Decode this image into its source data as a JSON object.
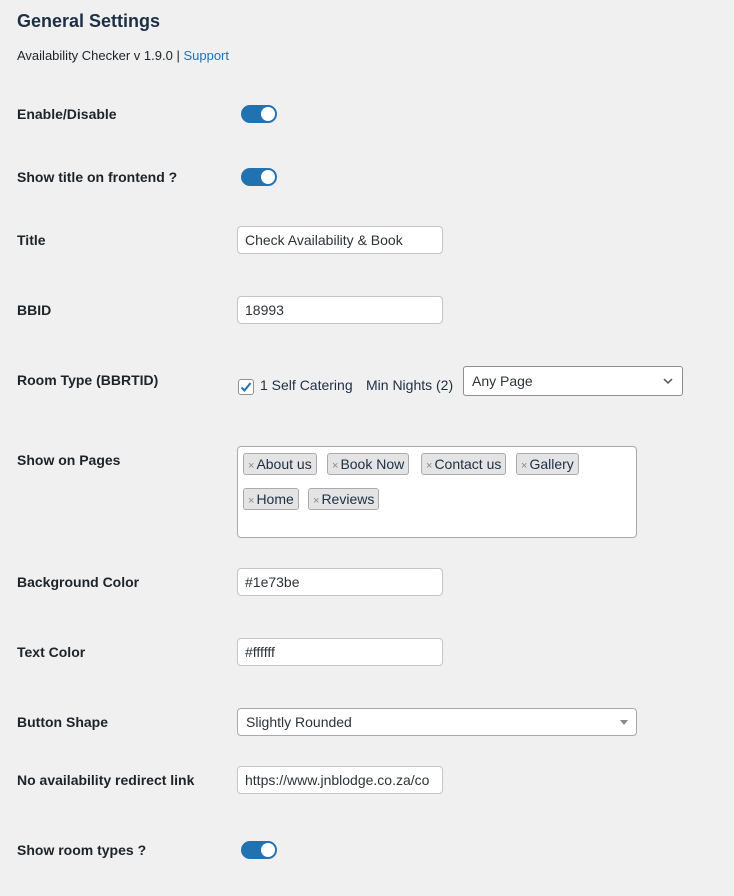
{
  "header": {
    "title": "General Settings",
    "plugin_version": "Availability Checker v 1.9.0 |",
    "support_link": "Support"
  },
  "fields": {
    "enable_disable": {
      "label": "Enable/Disable",
      "enabled": true
    },
    "show_title": {
      "label": "Show title on frontend ?",
      "enabled": true
    },
    "title": {
      "label": "Title",
      "value": "Check Availability & Book"
    },
    "bbid": {
      "label": "BBID",
      "value": "18993"
    },
    "room_type": {
      "label": "Room Type (BBRTID)",
      "option_label": "1 Self Catering",
      "checked": true,
      "min_nights": "Min Nights (2)",
      "page_select": "Any Page"
    },
    "show_on_pages": {
      "label": "Show on Pages",
      "tags": [
        "About us",
        "Book Now",
        "Contact us",
        "Gallery",
        "Home",
        "Reviews"
      ],
      "remove_glyph": "×"
    },
    "background_color": {
      "label": "Background Color",
      "value": "#1e73be"
    },
    "text_color": {
      "label": "Text Color",
      "value": "#ffffff"
    },
    "button_shape": {
      "label": "Button Shape",
      "value": "Slightly Rounded"
    },
    "redirect_link": {
      "label": "No availability redirect link",
      "value": "https://www.jnblodge.co.za/co"
    },
    "show_room_types": {
      "label": "Show room types ?",
      "enabled": true
    }
  },
  "colors": {
    "accent": "#2271b1",
    "heading": "#1d2f45"
  }
}
